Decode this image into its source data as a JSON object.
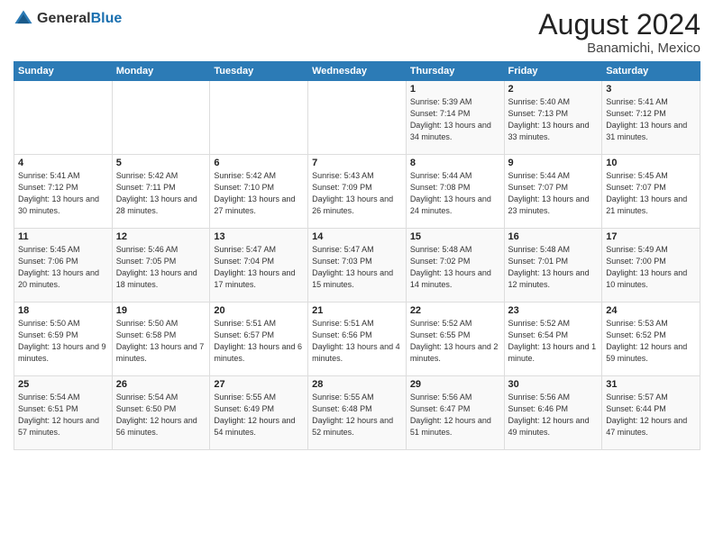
{
  "header": {
    "logo_general": "General",
    "logo_blue": "Blue",
    "main_title": "August 2024",
    "sub_title": "Banamichi, Mexico"
  },
  "columns": [
    "Sunday",
    "Monday",
    "Tuesday",
    "Wednesday",
    "Thursday",
    "Friday",
    "Saturday"
  ],
  "weeks": [
    [
      {
        "day": "",
        "sunrise": "",
        "sunset": "",
        "daylight": ""
      },
      {
        "day": "",
        "sunrise": "",
        "sunset": "",
        "daylight": ""
      },
      {
        "day": "",
        "sunrise": "",
        "sunset": "",
        "daylight": ""
      },
      {
        "day": "",
        "sunrise": "",
        "sunset": "",
        "daylight": ""
      },
      {
        "day": "1",
        "sunrise": "Sunrise: 5:39 AM",
        "sunset": "Sunset: 7:14 PM",
        "daylight": "Daylight: 13 hours and 34 minutes."
      },
      {
        "day": "2",
        "sunrise": "Sunrise: 5:40 AM",
        "sunset": "Sunset: 7:13 PM",
        "daylight": "Daylight: 13 hours and 33 minutes."
      },
      {
        "day": "3",
        "sunrise": "Sunrise: 5:41 AM",
        "sunset": "Sunset: 7:12 PM",
        "daylight": "Daylight: 13 hours and 31 minutes."
      }
    ],
    [
      {
        "day": "4",
        "sunrise": "Sunrise: 5:41 AM",
        "sunset": "Sunset: 7:12 PM",
        "daylight": "Daylight: 13 hours and 30 minutes."
      },
      {
        "day": "5",
        "sunrise": "Sunrise: 5:42 AM",
        "sunset": "Sunset: 7:11 PM",
        "daylight": "Daylight: 13 hours and 28 minutes."
      },
      {
        "day": "6",
        "sunrise": "Sunrise: 5:42 AM",
        "sunset": "Sunset: 7:10 PM",
        "daylight": "Daylight: 13 hours and 27 minutes."
      },
      {
        "day": "7",
        "sunrise": "Sunrise: 5:43 AM",
        "sunset": "Sunset: 7:09 PM",
        "daylight": "Daylight: 13 hours and 26 minutes."
      },
      {
        "day": "8",
        "sunrise": "Sunrise: 5:44 AM",
        "sunset": "Sunset: 7:08 PM",
        "daylight": "Daylight: 13 hours and 24 minutes."
      },
      {
        "day": "9",
        "sunrise": "Sunrise: 5:44 AM",
        "sunset": "Sunset: 7:07 PM",
        "daylight": "Daylight: 13 hours and 23 minutes."
      },
      {
        "day": "10",
        "sunrise": "Sunrise: 5:45 AM",
        "sunset": "Sunset: 7:07 PM",
        "daylight": "Daylight: 13 hours and 21 minutes."
      }
    ],
    [
      {
        "day": "11",
        "sunrise": "Sunrise: 5:45 AM",
        "sunset": "Sunset: 7:06 PM",
        "daylight": "Daylight: 13 hours and 20 minutes."
      },
      {
        "day": "12",
        "sunrise": "Sunrise: 5:46 AM",
        "sunset": "Sunset: 7:05 PM",
        "daylight": "Daylight: 13 hours and 18 minutes."
      },
      {
        "day": "13",
        "sunrise": "Sunrise: 5:47 AM",
        "sunset": "Sunset: 7:04 PM",
        "daylight": "Daylight: 13 hours and 17 minutes."
      },
      {
        "day": "14",
        "sunrise": "Sunrise: 5:47 AM",
        "sunset": "Sunset: 7:03 PM",
        "daylight": "Daylight: 13 hours and 15 minutes."
      },
      {
        "day": "15",
        "sunrise": "Sunrise: 5:48 AM",
        "sunset": "Sunset: 7:02 PM",
        "daylight": "Daylight: 13 hours and 14 minutes."
      },
      {
        "day": "16",
        "sunrise": "Sunrise: 5:48 AM",
        "sunset": "Sunset: 7:01 PM",
        "daylight": "Daylight: 13 hours and 12 minutes."
      },
      {
        "day": "17",
        "sunrise": "Sunrise: 5:49 AM",
        "sunset": "Sunset: 7:00 PM",
        "daylight": "Daylight: 13 hours and 10 minutes."
      }
    ],
    [
      {
        "day": "18",
        "sunrise": "Sunrise: 5:50 AM",
        "sunset": "Sunset: 6:59 PM",
        "daylight": "Daylight: 13 hours and 9 minutes."
      },
      {
        "day": "19",
        "sunrise": "Sunrise: 5:50 AM",
        "sunset": "Sunset: 6:58 PM",
        "daylight": "Daylight: 13 hours and 7 minutes."
      },
      {
        "day": "20",
        "sunrise": "Sunrise: 5:51 AM",
        "sunset": "Sunset: 6:57 PM",
        "daylight": "Daylight: 13 hours and 6 minutes."
      },
      {
        "day": "21",
        "sunrise": "Sunrise: 5:51 AM",
        "sunset": "Sunset: 6:56 PM",
        "daylight": "Daylight: 13 hours and 4 minutes."
      },
      {
        "day": "22",
        "sunrise": "Sunrise: 5:52 AM",
        "sunset": "Sunset: 6:55 PM",
        "daylight": "Daylight: 13 hours and 2 minutes."
      },
      {
        "day": "23",
        "sunrise": "Sunrise: 5:52 AM",
        "sunset": "Sunset: 6:54 PM",
        "daylight": "Daylight: 13 hours and 1 minute."
      },
      {
        "day": "24",
        "sunrise": "Sunrise: 5:53 AM",
        "sunset": "Sunset: 6:52 PM",
        "daylight": "Daylight: 12 hours and 59 minutes."
      }
    ],
    [
      {
        "day": "25",
        "sunrise": "Sunrise: 5:54 AM",
        "sunset": "Sunset: 6:51 PM",
        "daylight": "Daylight: 12 hours and 57 minutes."
      },
      {
        "day": "26",
        "sunrise": "Sunrise: 5:54 AM",
        "sunset": "Sunset: 6:50 PM",
        "daylight": "Daylight: 12 hours and 56 minutes."
      },
      {
        "day": "27",
        "sunrise": "Sunrise: 5:55 AM",
        "sunset": "Sunset: 6:49 PM",
        "daylight": "Daylight: 12 hours and 54 minutes."
      },
      {
        "day": "28",
        "sunrise": "Sunrise: 5:55 AM",
        "sunset": "Sunset: 6:48 PM",
        "daylight": "Daylight: 12 hours and 52 minutes."
      },
      {
        "day": "29",
        "sunrise": "Sunrise: 5:56 AM",
        "sunset": "Sunset: 6:47 PM",
        "daylight": "Daylight: 12 hours and 51 minutes."
      },
      {
        "day": "30",
        "sunrise": "Sunrise: 5:56 AM",
        "sunset": "Sunset: 6:46 PM",
        "daylight": "Daylight: 12 hours and 49 minutes."
      },
      {
        "day": "31",
        "sunrise": "Sunrise: 5:57 AM",
        "sunset": "Sunset: 6:44 PM",
        "daylight": "Daylight: 12 hours and 47 minutes."
      }
    ]
  ]
}
